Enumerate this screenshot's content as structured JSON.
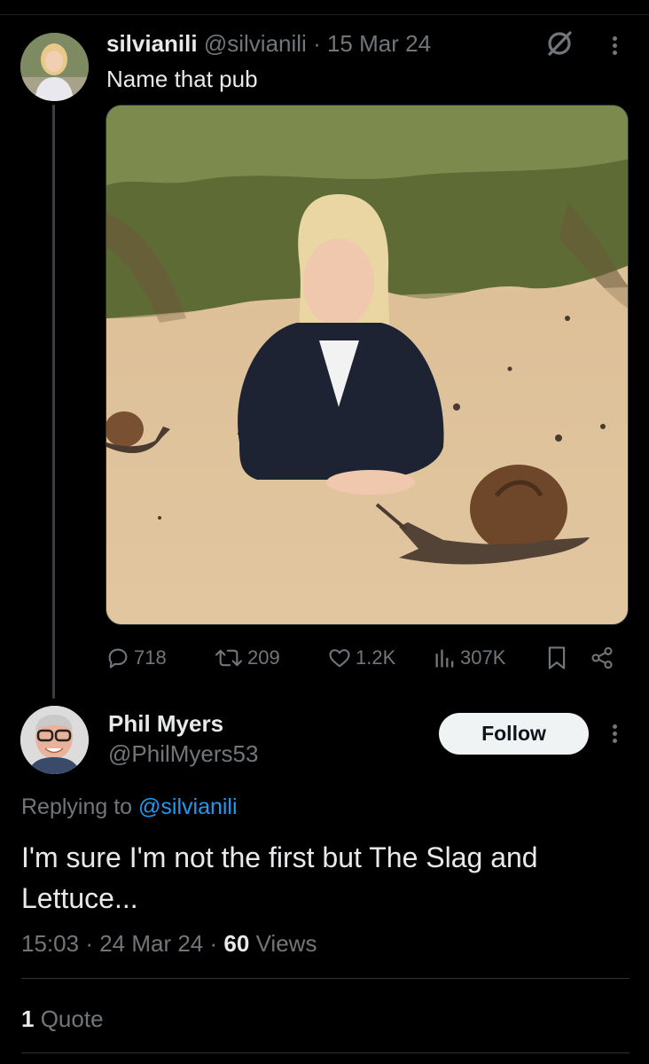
{
  "tweet": {
    "author_name": "silvianili",
    "author_handle": "@silvianili",
    "date": "15 Mar 24",
    "text": "Name that pub",
    "media_description": "AI-generated photo: blonde woman in dark blazer lying on sand dunes with two large snails",
    "stats": {
      "replies": "718",
      "reposts": "209",
      "likes": "1.2K",
      "views": "307K"
    }
  },
  "reply": {
    "author_name": "Phil Myers",
    "author_handle": "@PhilMyers53",
    "follow_label": "Follow",
    "replying_prefix": "Replying to ",
    "replying_to": "@silvianili",
    "text": "I'm sure I'm not the first but The Slag and Lettuce...",
    "time": "15:03",
    "date": "24 Mar 24",
    "views_count": "60",
    "views_label": "Views",
    "quote_count": "1",
    "quote_label": "Quote"
  },
  "colors": {
    "background": "#000000",
    "text_primary": "#e7e9ea",
    "text_secondary": "#71767b",
    "link": "#1d9bf0",
    "follow_button_bg": "#eff3f4"
  },
  "icons": [
    "grok-icon",
    "more-icon",
    "reply-icon",
    "repost-icon",
    "like-icon",
    "views-icon",
    "bookmark-icon",
    "share-icon"
  ]
}
